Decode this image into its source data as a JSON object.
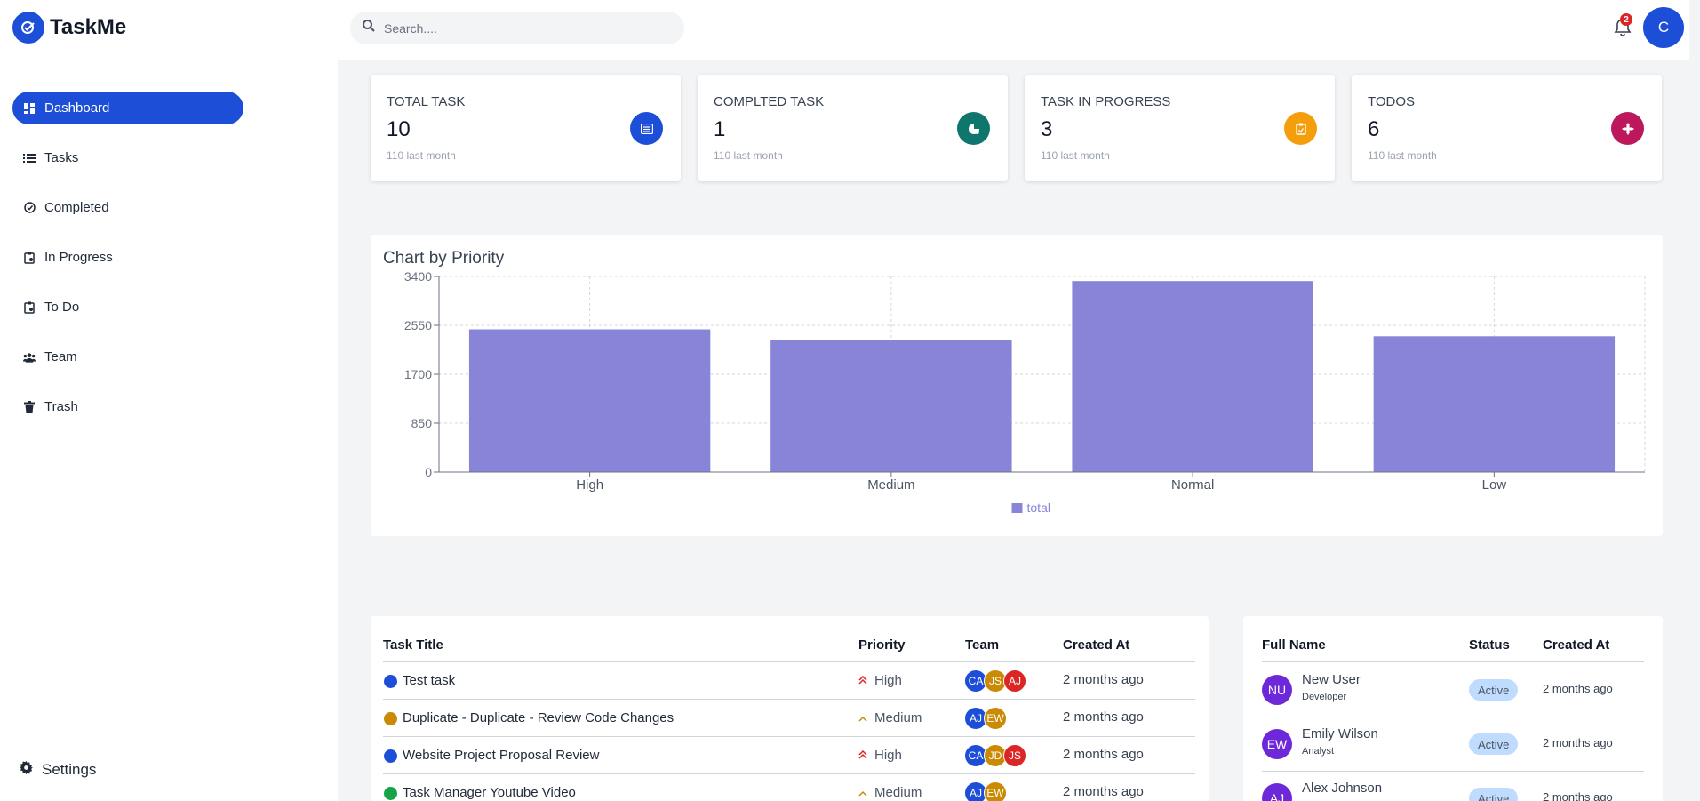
{
  "app": {
    "name": "TaskMe"
  },
  "sidebar": {
    "items": [
      {
        "label": "Dashboard",
        "icon": "dashboard-icon",
        "active": true
      },
      {
        "label": "Tasks",
        "icon": "list-icon"
      },
      {
        "label": "Completed",
        "icon": "check-circle-icon"
      },
      {
        "label": "In Progress",
        "icon": "clipboard-icon"
      },
      {
        "label": "To Do",
        "icon": "clipboard-icon"
      },
      {
        "label": "Team",
        "icon": "users-icon"
      },
      {
        "label": "Trash",
        "icon": "trash-icon"
      }
    ],
    "settings_label": "Settings"
  },
  "header": {
    "search_placeholder": "Search....",
    "notification_count": "2",
    "user_initial": "C"
  },
  "stats": [
    {
      "label": "TOTAL TASK",
      "value": "10",
      "sub": "110 last month",
      "color": "#1d4ed8"
    },
    {
      "label": "COMPLTED TASK",
      "value": "1",
      "sub": "110 last month",
      "color": "#0f766e"
    },
    {
      "label": "TASK IN PROGRESS",
      "value": "3",
      "sub": "110 last month",
      "color": "#f59e0b"
    },
    {
      "label": "TODOS",
      "value": "6",
      "sub": "110 last month",
      "color": "#be185d"
    }
  ],
  "chart_title": "Chart by Priority",
  "chart_data": {
    "type": "bar",
    "categories": [
      "High",
      "Medium",
      "Normal",
      "Low"
    ],
    "series": [
      {
        "name": "total",
        "values": [
          2480,
          2290,
          3320,
          2360
        ],
        "color": "#8884d8"
      }
    ],
    "yticks": [
      0,
      850,
      1700,
      2550,
      3400
    ],
    "ylim": [
      0,
      3400
    ],
    "grid": true,
    "legend": "bottom"
  },
  "task_table": {
    "headers": {
      "title": "Task Title",
      "priority": "Priority",
      "team": "Team",
      "created": "Created At"
    },
    "rows": [
      {
        "title": "Test task",
        "dot_color": "#1d4ed8",
        "priority": "High",
        "priority_color": "#dc2626",
        "team": [
          {
            "initials": "CA",
            "color": "#1d4ed8"
          },
          {
            "initials": "JS",
            "color": "#ca8a04"
          },
          {
            "initials": "AJ",
            "color": "#dc2626"
          }
        ],
        "created": "2 months ago"
      },
      {
        "title": "Duplicate - Duplicate - Review Code Changes",
        "dot_color": "#ca8a04",
        "priority": "Medium",
        "priority_color": "#ca8a04",
        "team": [
          {
            "initials": "AJ",
            "color": "#1d4ed8"
          },
          {
            "initials": "EW",
            "color": "#ca8a04"
          }
        ],
        "created": "2 months ago"
      },
      {
        "title": "Website Project Proposal Review",
        "dot_color": "#1d4ed8",
        "priority": "High",
        "priority_color": "#dc2626",
        "team": [
          {
            "initials": "CA",
            "color": "#1d4ed8"
          },
          {
            "initials": "JD",
            "color": "#ca8a04"
          },
          {
            "initials": "JS",
            "color": "#dc2626"
          }
        ],
        "created": "2 months ago"
      },
      {
        "title": "Task Manager Youtube Video",
        "dot_color": "#16a34a",
        "priority": "Medium",
        "priority_color": "#ca8a04",
        "team": [
          {
            "initials": "AJ",
            "color": "#1d4ed8"
          },
          {
            "initials": "EW",
            "color": "#ca8a04"
          }
        ],
        "created": "2 months ago"
      }
    ]
  },
  "user_table": {
    "headers": {
      "name": "Full Name",
      "status": "Status",
      "created": "Created At"
    },
    "rows": [
      {
        "initials": "NU",
        "name": "New User",
        "role": "Developer",
        "status": "Active",
        "created": "2 months ago"
      },
      {
        "initials": "EW",
        "name": "Emily Wilson",
        "role": "Analyst",
        "status": "Active",
        "created": "2 months ago"
      },
      {
        "initials": "AJ",
        "name": "Alex Johnson",
        "role": "",
        "status": "Active",
        "created": "2 months ago"
      }
    ]
  }
}
